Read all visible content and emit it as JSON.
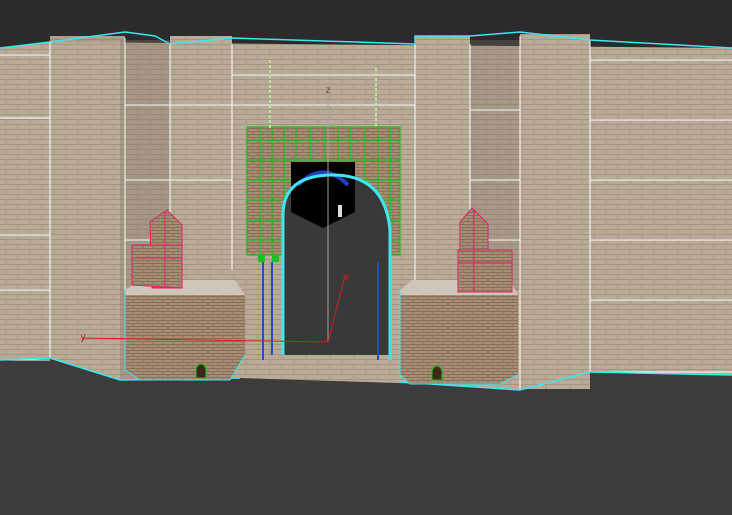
{
  "viewport": {
    "axis_labels": {
      "x": "x",
      "y": "y",
      "z": "z"
    }
  },
  "colors": {
    "background_top": "#2b2b2b",
    "ground": "#3c3c3c",
    "wall": "#b7aa96",
    "selection_cyan": "#3fe6f0",
    "wire_green": "#19c21c",
    "wire_magenta": "#e0206a",
    "gizmo_red": "#d02020"
  }
}
